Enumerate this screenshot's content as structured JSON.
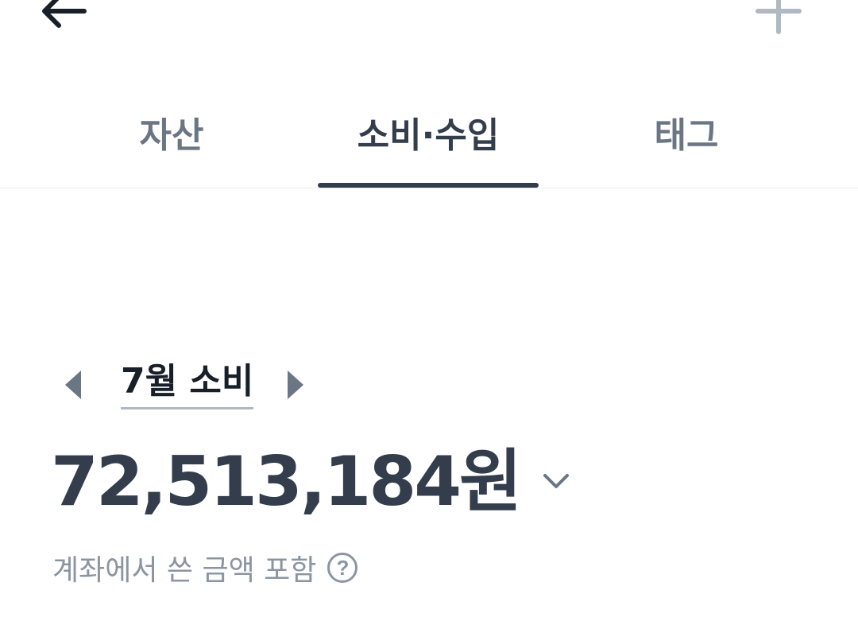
{
  "header": {
    "back_icon": "arrow-left-icon",
    "add_icon": "plus-icon"
  },
  "tabs": [
    {
      "label": "자산",
      "active": false
    },
    {
      "label": "소비·수입",
      "active": true
    },
    {
      "label": "태그",
      "active": false
    }
  ],
  "summary": {
    "month_label": "7월 소비",
    "prev_icon": "caret-left-icon",
    "next_icon": "caret-right-icon",
    "amount": "72,513,184원",
    "toggle_icon": "chevron-down-icon",
    "note": "계좌에서 쓴 금액 포함",
    "help_glyph": "?"
  },
  "colors": {
    "primary_text": "#333d4b",
    "secondary_text": "#6b7684",
    "muted_text": "#8b95a1",
    "divider": "#e8ebee"
  }
}
